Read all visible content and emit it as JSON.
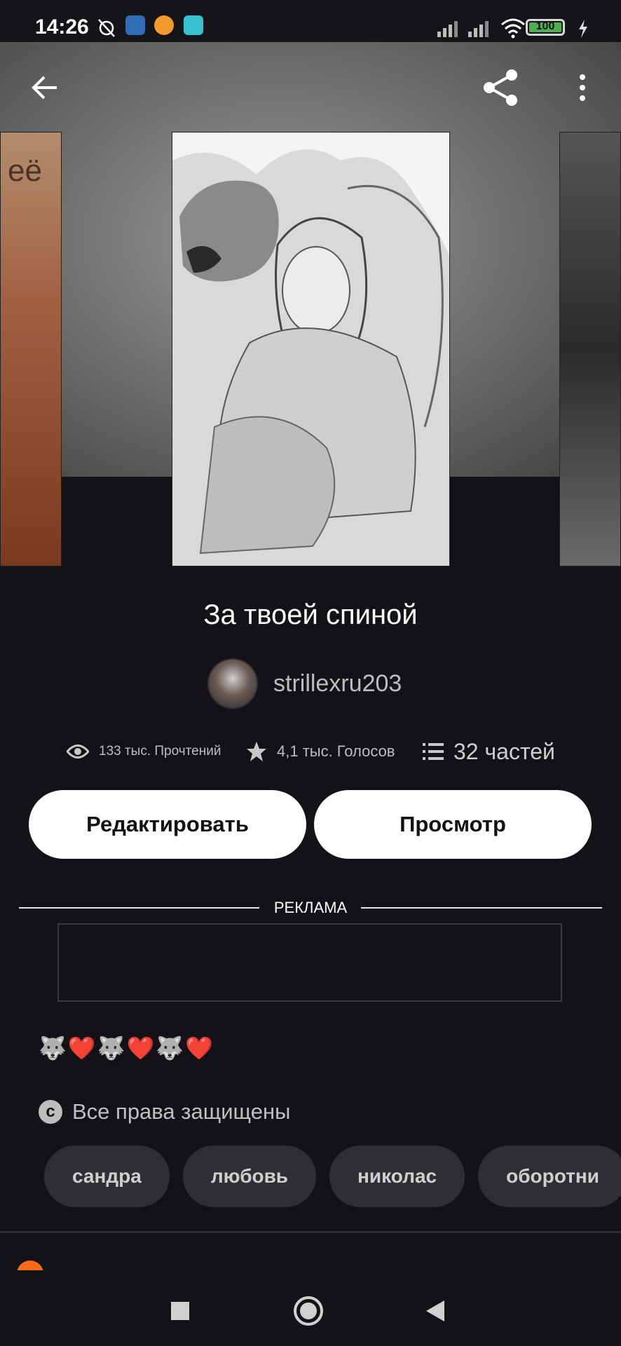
{
  "status_bar": {
    "time": "14:26",
    "battery": "100"
  },
  "book": {
    "title": "За твоей спиной",
    "cover_left_text": "её",
    "author": "strillexru203"
  },
  "stats": {
    "reads": "133 тыс. Прочтений",
    "votes": "4,1 тыс. Голосов",
    "parts": "32 частей"
  },
  "buttons": {
    "edit": "Редактировать",
    "view": "Просмотр"
  },
  "ad": {
    "label": "РЕКЛАМА"
  },
  "description": {
    "emojis": [
      "🐺",
      "❤️",
      "🐺",
      "❤️",
      "🐺",
      "❤️"
    ]
  },
  "copyright": "Все права защищены",
  "tags": [
    "сандра",
    "любовь",
    "николас",
    "оборотни"
  ],
  "colors": {
    "background": "#141216",
    "button_bg": "#ffffff",
    "tag_bg": "#2f2e33",
    "accent": "#ff6a1a"
  },
  "icons": [
    "back-arrow-icon",
    "share-icon",
    "more-vert-icon",
    "eye-icon",
    "star-icon",
    "list-icon",
    "copyright-icon",
    "stop-square-icon",
    "home-circle-icon",
    "back-triangle-icon"
  ]
}
